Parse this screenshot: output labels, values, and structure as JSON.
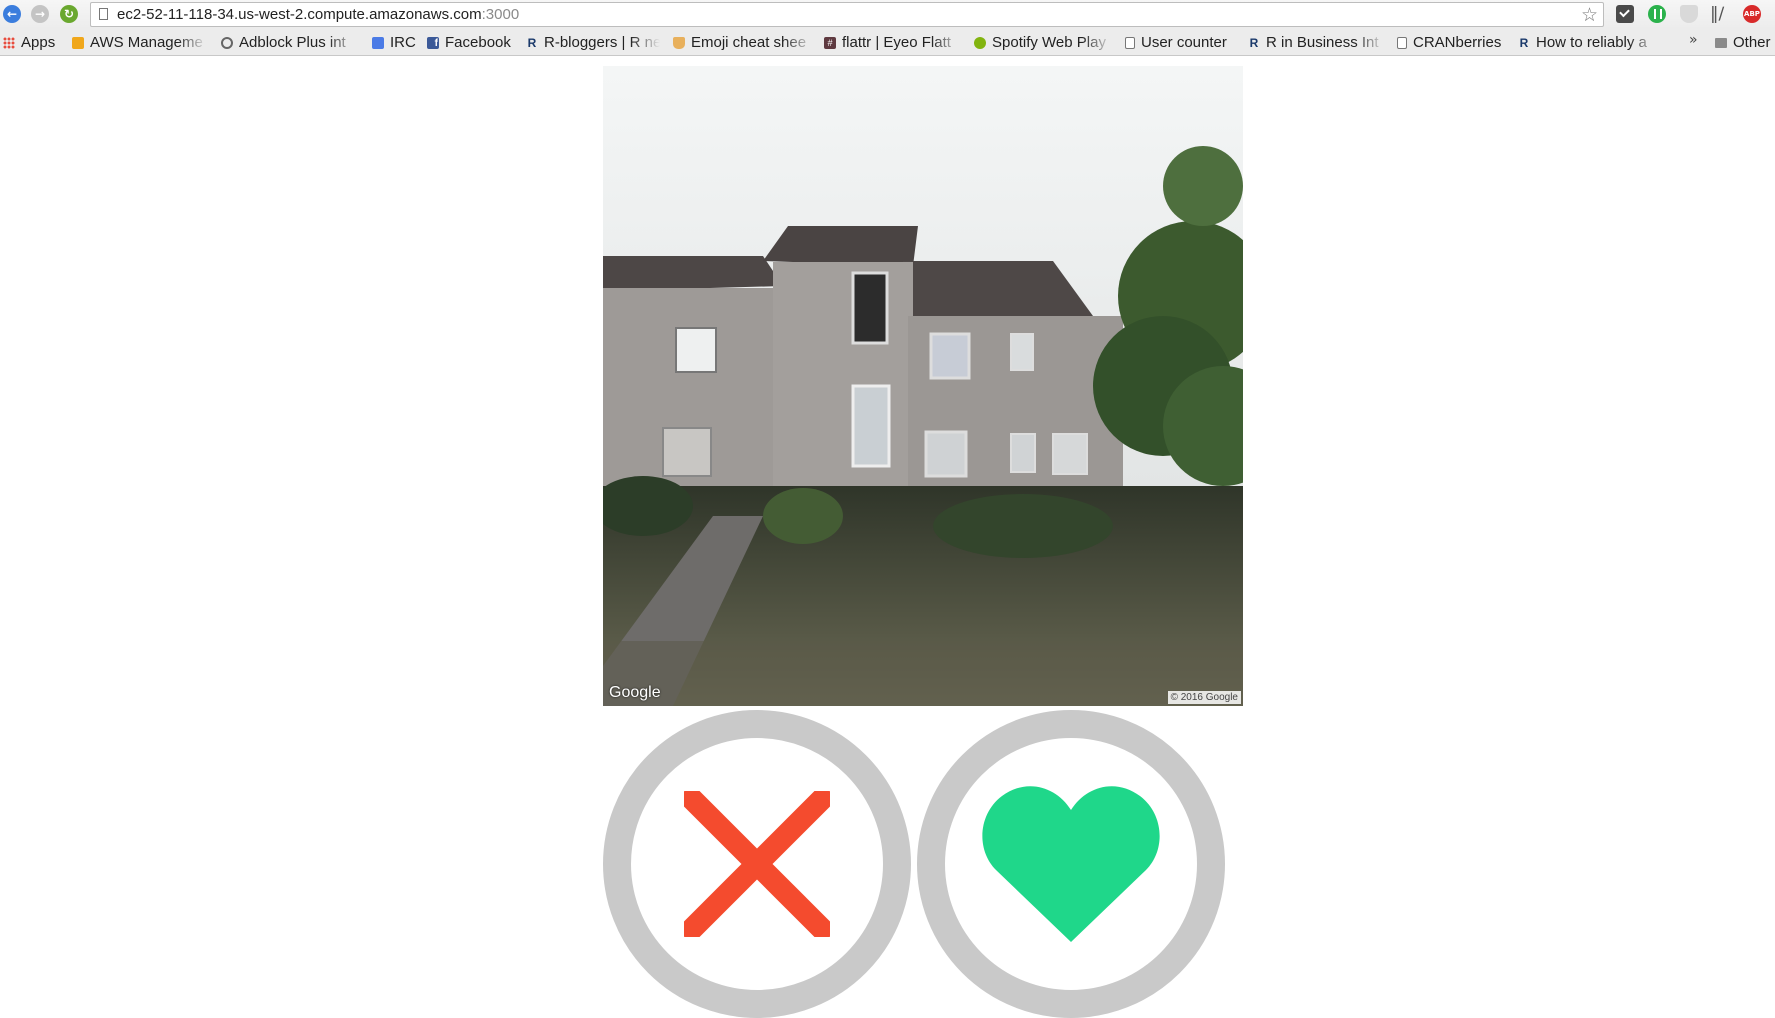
{
  "browser": {
    "url_host": "ec2-52-11-118-34.us-west-2.compute.amazonaws.com",
    "url_port": ":3000",
    "toolbar_icons": [
      "back-icon",
      "forward-icon",
      "reload-icon",
      "star-icon",
      "pocket-icon",
      "green-extension-icon",
      "shield-icon",
      "books-icon",
      "adblock-plus-icon"
    ],
    "extension_abp_text": "ABP",
    "bookmarks": [
      {
        "label": "Apps",
        "icon": "apps-icon"
      },
      {
        "label": "AWS Manageme",
        "icon": "aws-icon"
      },
      {
        "label": "Adblock Plus int",
        "icon": "adblock-icon"
      },
      {
        "label": "IRC",
        "icon": "irc-icon"
      },
      {
        "label": "Facebook",
        "icon": "facebook-icon"
      },
      {
        "label": "R-bloggers | R ne",
        "icon": "r-icon"
      },
      {
        "label": "Emoji cheat shee",
        "icon": "thumb-icon"
      },
      {
        "label": "flattr | Eyeo Flatt",
        "icon": "flattr-icon"
      },
      {
        "label": "Spotify Web Play",
        "icon": "spotify-icon"
      },
      {
        "label": "User counter",
        "icon": "page-icon"
      },
      {
        "label": "R in Business Int",
        "icon": "r-icon"
      },
      {
        "label": "CRANberries",
        "icon": "page-icon"
      },
      {
        "label": "How to reliably a",
        "icon": "r-icon"
      }
    ],
    "overflow_chevron": "»",
    "other_bookmarks": "Other"
  },
  "streetview": {
    "provider_label": "Google",
    "copyright": "© 2016 Google"
  },
  "actions": {
    "reject_icon": "cross-icon",
    "like_icon": "heart-icon",
    "colors": {
      "reject": "#f44b2e",
      "like": "#1fd78a",
      "ring": "#c9c9c9"
    }
  }
}
